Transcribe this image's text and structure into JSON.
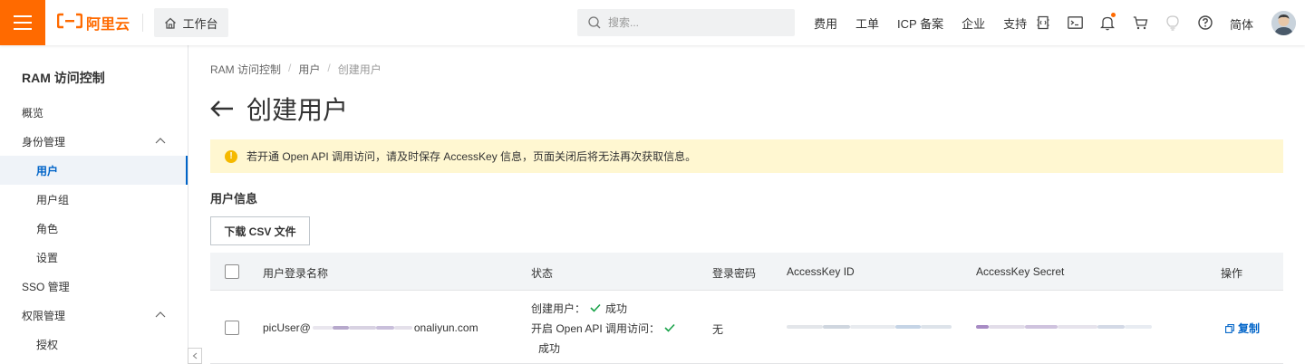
{
  "topbar": {
    "brand": "阿里云",
    "workbench_label": "工作台",
    "search_placeholder": "搜索...",
    "nav_links": [
      "费用",
      "工单",
      "ICP 备案",
      "企业",
      "支持"
    ],
    "language": "简体",
    "accent_color": "#ff6a00"
  },
  "sidebar": {
    "title": "RAM 访问控制",
    "items": [
      {
        "label": "概览",
        "level": 1
      },
      {
        "label": "身份管理",
        "level": 1,
        "expanded": true
      },
      {
        "label": "用户",
        "level": 2,
        "active": true
      },
      {
        "label": "用户组",
        "level": 2
      },
      {
        "label": "角色",
        "level": 2
      },
      {
        "label": "设置",
        "level": 2
      },
      {
        "label": "SSO 管理",
        "level": 1
      },
      {
        "label": "权限管理",
        "level": 1,
        "expanded": true
      },
      {
        "label": "授权",
        "level": 2
      }
    ]
  },
  "breadcrumb": [
    "RAM 访问控制",
    "用户",
    "创建用户"
  ],
  "page": {
    "title": "创建用户",
    "alert": "若开通 Open API 调用访问，请及时保存 AccessKey 信息，页面关闭后将无法再次获取信息。",
    "section_title": "用户信息",
    "download_button": "下载 CSV 文件"
  },
  "table": {
    "columns": [
      "用户登录名称",
      "状态",
      "登录密码",
      "AccessKey ID",
      "AccessKey Secret",
      "操作"
    ],
    "rows": [
      {
        "login_name_prefix": "picUser@",
        "login_name_suffix": "onaliyun.com",
        "status_create_label": "创建用户：",
        "status_create_value": "成功",
        "status_api_label": "开启 Open API 调用访问：",
        "status_api_value": "成功",
        "password": "无",
        "action": "复制"
      }
    ]
  }
}
